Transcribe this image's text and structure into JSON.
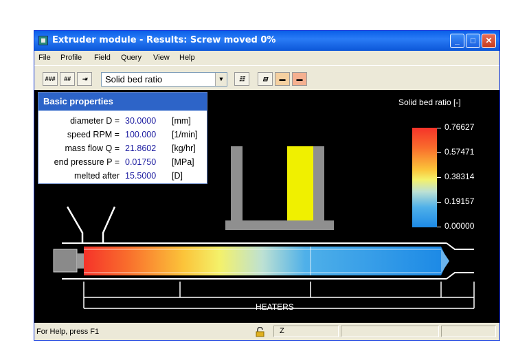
{
  "window": {
    "title": "Extruder module - Results: Screw moved 0%",
    "controls": {
      "minimize": "_",
      "maximize": "□",
      "close": "✕"
    }
  },
  "menu": [
    "File",
    "Profile",
    "Field",
    "Query",
    "View",
    "Help"
  ],
  "toolbar": {
    "field_select": "Solid bed ratio",
    "icons": [
      "hatch-icon",
      "hatch-alt-icon",
      "sort-icon",
      "table-icon",
      "screw-icon",
      "heater-icon",
      "heater-alt-icon"
    ]
  },
  "properties": {
    "title": "Basic properties",
    "rows": [
      {
        "label": "diameter D =",
        "value": "30.0000",
        "unit": "[mm]"
      },
      {
        "label": "speed RPM =",
        "value": "100.000",
        "unit": "[1/min]"
      },
      {
        "label": "mass flow Q =",
        "value": "21.8602",
        "unit": "[kg/hr]"
      },
      {
        "label": "end pressure P =",
        "value": "0.01750",
        "unit": "[MPa]"
      },
      {
        "label": "melted after",
        "value": "15.5000",
        "unit": "[D]"
      }
    ]
  },
  "legend": {
    "title": "Solid bed ratio  [-]",
    "values": [
      "0.76627",
      "0.57471",
      "0.38314",
      "0.19157",
      "0.00000"
    ],
    "colors": {
      "max": "#f5332a",
      "mid": "#f4f16a",
      "min": "#1d8ae6"
    }
  },
  "channel": {
    "solid_bed_fill": 1.0,
    "fill_color": "#f0f000"
  },
  "extruder": {
    "heaters_label": "HEATERS"
  },
  "status": {
    "help_text": "For Help, press F1",
    "mode": "Z"
  }
}
